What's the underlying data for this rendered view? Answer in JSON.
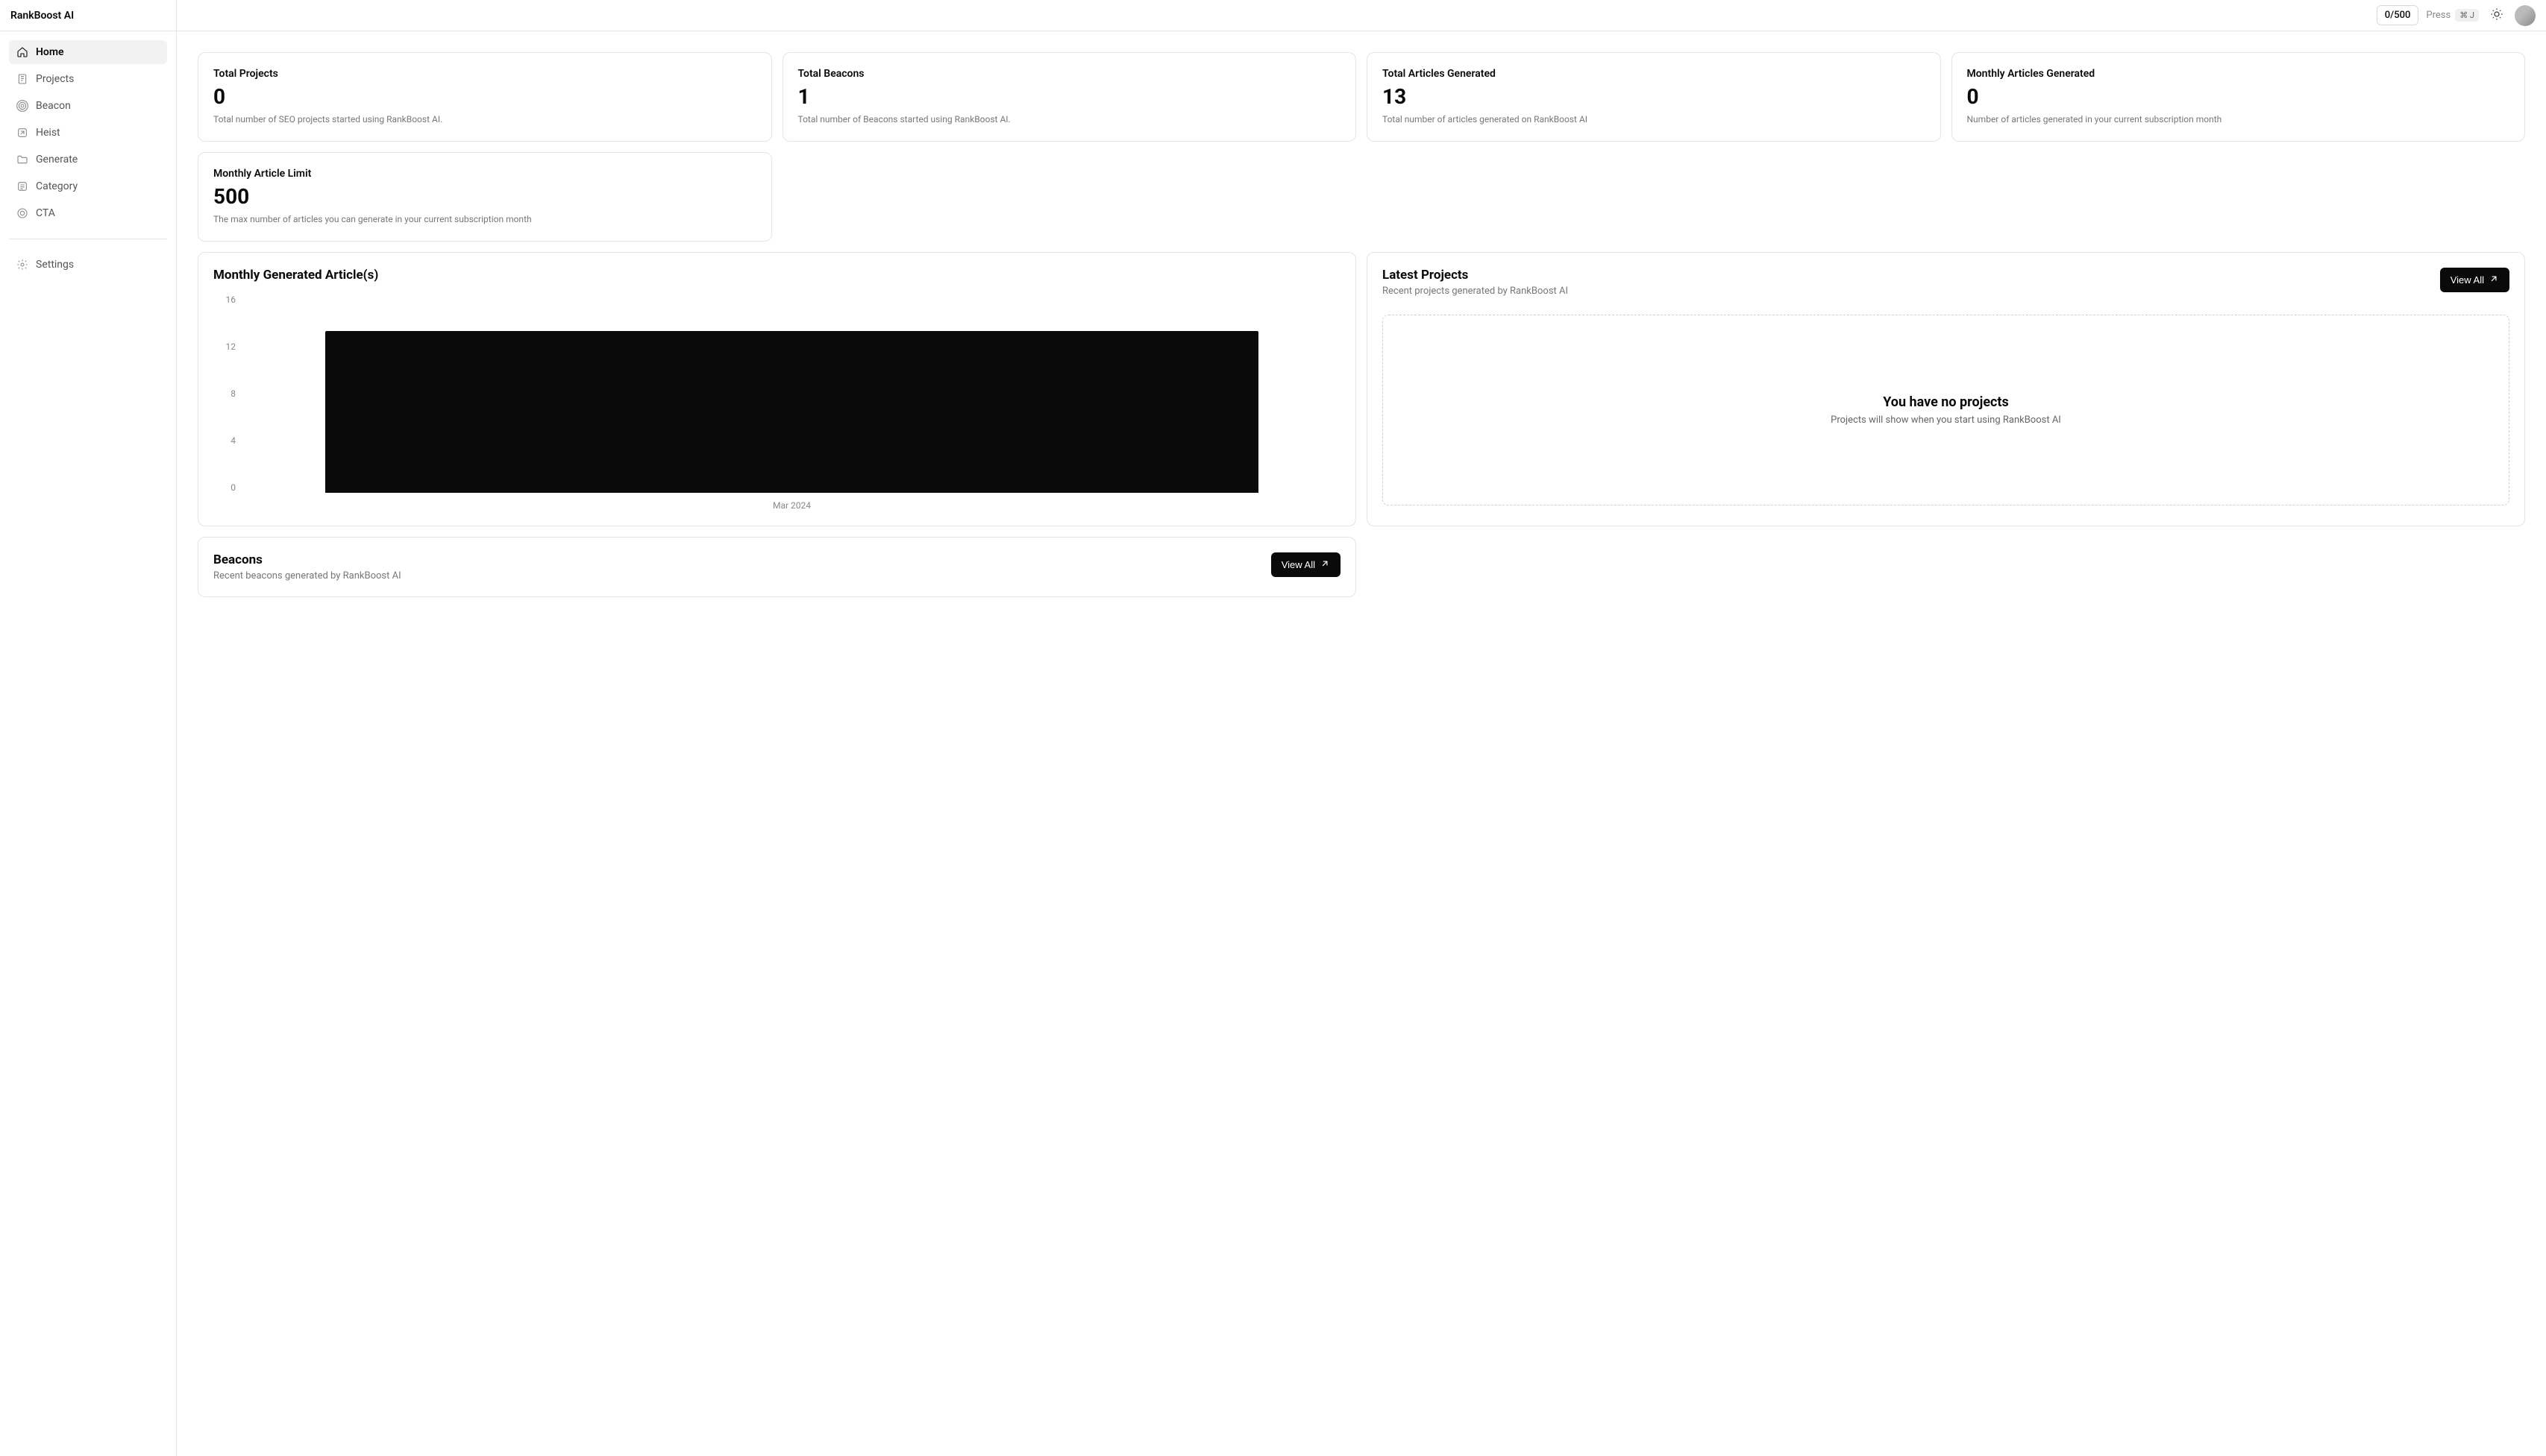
{
  "app_name": "RankBoost AI",
  "topbar": {
    "usage": "0/500",
    "press_label": "Press",
    "press_kbd": "⌘  J"
  },
  "sidebar": {
    "items": [
      {
        "label": "Home",
        "icon": "home-icon",
        "active": true
      },
      {
        "label": "Projects",
        "icon": "projects-icon",
        "active": false
      },
      {
        "label": "Beacon",
        "icon": "beacon-icon",
        "active": false
      },
      {
        "label": "Heist",
        "icon": "heist-icon",
        "active": false
      },
      {
        "label": "Generate",
        "icon": "generate-icon",
        "active": false
      },
      {
        "label": "Category",
        "icon": "category-icon",
        "active": false
      },
      {
        "label": "CTA",
        "icon": "cta-icon",
        "active": false
      }
    ],
    "settings_label": "Settings"
  },
  "stats": [
    {
      "title": "Total Projects",
      "value": "0",
      "desc": "Total number of SEO projects started using RankBoost AI."
    },
    {
      "title": "Total Beacons",
      "value": "1",
      "desc": "Total number of Beacons started using RankBoost AI."
    },
    {
      "title": "Total Articles Generated",
      "value": "13",
      "desc": "Total number of articles generated on RankBoost AI"
    },
    {
      "title": "Monthly Articles Generated",
      "value": "0",
      "desc": "Number of articles generated in your current subscription month"
    }
  ],
  "stats2": [
    {
      "title": "Monthly Article Limit",
      "value": "500",
      "desc": "The max number of articles you can generate in your current subscription month"
    }
  ],
  "chart_panel": {
    "title": "Monthly Generated Article(s)"
  },
  "chart_data": {
    "type": "bar",
    "categories": [
      "Mar 2024"
    ],
    "values": [
      13
    ],
    "title": "Monthly Generated Article(s)",
    "xlabel": "",
    "ylabel": "",
    "ylim": [
      0,
      16
    ],
    "yticks": [
      0,
      4,
      8,
      12,
      16
    ]
  },
  "latest_projects": {
    "title": "Latest Projects",
    "subtitle": "Recent projects generated by RankBoost AI",
    "view_all": "View All",
    "empty_title": "You have no projects",
    "empty_desc": "Projects will show when you start using RankBoost AI"
  },
  "beacons_panel": {
    "title": "Beacons",
    "subtitle": "Recent beacons generated by RankBoost AI",
    "view_all": "View All"
  }
}
